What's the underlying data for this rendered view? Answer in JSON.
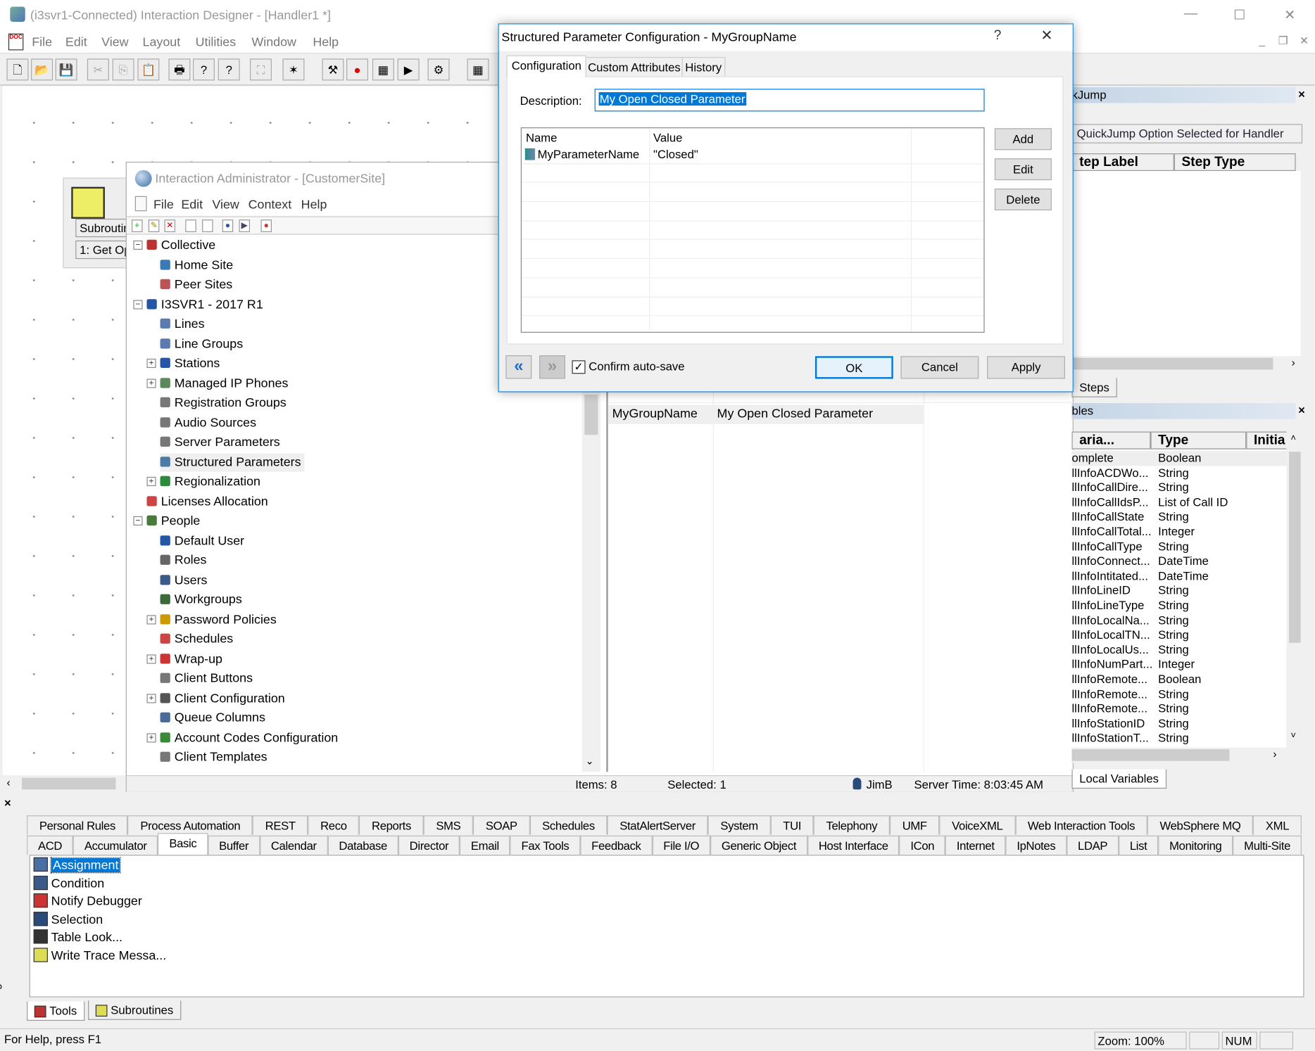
{
  "window": {
    "title": "(i3svr1-Connected) Interaction Designer - [Handler1 *]",
    "controls": [
      "—",
      "☐",
      "✕"
    ],
    "mdi_controls": [
      "_",
      "❐",
      "✕"
    ]
  },
  "menu": [
    "File",
    "Edit",
    "View",
    "Layout",
    "Utilities",
    "Window",
    "Help"
  ],
  "toolbar": [
    "new-icon",
    "open-icon",
    "save-icon",
    "cut-icon",
    "copy-icon",
    "paste-icon",
    "print-icon",
    "help-icon",
    "context-help-icon",
    "publish-icon",
    "debug-icon",
    "tools-icon",
    "stop-icon",
    "grid-icon",
    "step-icon",
    "variables-icon",
    "layout-grid-icon"
  ],
  "canvas": {
    "step_title": "Subroutin",
    "step_label": "1: Get Op"
  },
  "admin": {
    "title": "Interaction Administrator - [CustomerSite]",
    "menu": [
      "File",
      "Edit",
      "View",
      "Context",
      "Help"
    ],
    "tree": [
      {
        "label": "Collective",
        "level": 0,
        "exp": "-",
        "color": "#b33"
      },
      {
        "label": "Home Site",
        "level": 1,
        "color": "#3a7ab5"
      },
      {
        "label": "Peer Sites",
        "level": 1,
        "color": "#b55"
      },
      {
        "label": "I3SVR1 - 2017 R1",
        "level": 0,
        "exp": "-",
        "color": "#2456a5"
      },
      {
        "label": "Lines",
        "level": 1,
        "color": "#5a7ab0"
      },
      {
        "label": "Line Groups",
        "level": 1,
        "color": "#5a7ab0"
      },
      {
        "label": "Stations",
        "level": 1,
        "exp": "+",
        "color": "#2456a5"
      },
      {
        "label": "Managed IP Phones",
        "level": 1,
        "exp": "+",
        "color": "#5a8a5a"
      },
      {
        "label": "Registration Groups",
        "level": 1,
        "color": "#777"
      },
      {
        "label": "Audio Sources",
        "level": 1,
        "color": "#777"
      },
      {
        "label": "Server Parameters",
        "level": 1,
        "color": "#777"
      },
      {
        "label": "Structured Parameters",
        "level": 1,
        "color": "#4a7aa5",
        "selected": true
      },
      {
        "label": "Regionalization",
        "level": 1,
        "exp": "+",
        "color": "#2a8a3a"
      },
      {
        "label": "Licenses Allocation",
        "level": 0,
        "color": "#c44"
      },
      {
        "label": "People",
        "level": 0,
        "exp": "-",
        "color": "#4a7a3a"
      },
      {
        "label": "Default User",
        "level": 1,
        "color": "#2456a5"
      },
      {
        "label": "Roles",
        "level": 1,
        "color": "#666"
      },
      {
        "label": "Users",
        "level": 1,
        "color": "#3a5a8a"
      },
      {
        "label": "Workgroups",
        "level": 1,
        "color": "#3a6a3a"
      },
      {
        "label": "Password Policies",
        "level": 1,
        "exp": "+",
        "color": "#c90"
      },
      {
        "label": "Schedules",
        "level": 1,
        "color": "#c44"
      },
      {
        "label": "Wrap-up",
        "level": 1,
        "exp": "+",
        "color": "#c33"
      },
      {
        "label": "Client Buttons",
        "level": 1,
        "color": "#777"
      },
      {
        "label": "Client Configuration",
        "level": 1,
        "exp": "+",
        "color": "#555"
      },
      {
        "label": "Queue Columns",
        "level": 1,
        "color": "#4a6a9a"
      },
      {
        "label": "Account Codes Configuration",
        "level": 1,
        "exp": "+",
        "color": "#3a8a3a"
      },
      {
        "label": "Client Templates",
        "level": 1,
        "color": "#777"
      }
    ],
    "list_rows": [
      {
        "name": "MyGroupName",
        "description": "My Open Closed Parameter"
      }
    ],
    "status": {
      "items": "Items: 8",
      "selected": "Selected: 1",
      "user": "JimB",
      "server_time": "Server Time: 8:03:45 AM"
    }
  },
  "dialog": {
    "title": "Structured Parameter Configuration - MyGroupName",
    "help": "?",
    "close": "✕",
    "tabs": [
      "Configuration",
      "Custom Attributes",
      "History"
    ],
    "active_tab": "Configuration",
    "description_label": "Description:",
    "description_value": "My Open Closed Parameter",
    "columns": [
      "Name",
      "Value"
    ],
    "rows": [
      {
        "name": "MyParameterName",
        "value": "\"Closed\""
      }
    ],
    "buttons": {
      "add": "Add",
      "edit": "Edit",
      "delete": "Delete",
      "ok": "OK",
      "cancel": "Cancel",
      "apply": "Apply",
      "prev": "«",
      "next": "»"
    },
    "confirm_autosave": {
      "label": "Confirm auto-save",
      "checked": true
    }
  },
  "quickjump": {
    "title": "kJump",
    "option": "QuickJump Option Selected for Handler",
    "columns": [
      "tep Label",
      "Step Type"
    ],
    "tab": "Steps"
  },
  "variables": {
    "title": "bles",
    "columns": [
      "aria...",
      "Type",
      "Initia"
    ],
    "tab": "Local Variables",
    "rows": [
      [
        "omplete",
        "Boolean"
      ],
      [
        "llInfoACDWo...",
        "String"
      ],
      [
        "llInfoCallDire...",
        "String"
      ],
      [
        "llInfoCallIdsP...",
        "List of Call ID"
      ],
      [
        "llInfoCallState",
        "String"
      ],
      [
        "llInfoCallTotal...",
        "Integer"
      ],
      [
        "llInfoCallType",
        "String"
      ],
      [
        "llInfoConnect...",
        "DateTime"
      ],
      [
        "llInfoIntitated...",
        "DateTime"
      ],
      [
        "llInfoLineID",
        "String"
      ],
      [
        "llInfoLineType",
        "String"
      ],
      [
        "llInfoLocalNa...",
        "String"
      ],
      [
        "llInfoLocalTN...",
        "String"
      ],
      [
        "llInfoLocalUs...",
        "String"
      ],
      [
        "llInfoNumPart...",
        "Integer"
      ],
      [
        "llInfoRemote...",
        "Boolean"
      ],
      [
        "llInfoRemote...",
        "String"
      ],
      [
        "llInfoRemote...",
        "String"
      ],
      [
        "llInfoStationID",
        "String"
      ],
      [
        "llInfoStationT...",
        "String"
      ]
    ]
  },
  "tools": {
    "tabs_row1": [
      "Personal Rules",
      "Process Automation",
      "REST",
      "Reco",
      "Reports",
      "SMS",
      "SOAP",
      "Schedules",
      "StatAlertServer",
      "System",
      "TUI",
      "Telephony",
      "UMF",
      "VoiceXML",
      "Web Interaction Tools",
      "WebSphere MQ",
      "XML"
    ],
    "tabs_row2": [
      "ACD",
      "Accumulator",
      "Basic",
      "Buffer",
      "Calendar",
      "Database",
      "Director",
      "Email",
      "Fax Tools",
      "Feedback",
      "File I/O",
      "Generic Object",
      "Host Interface",
      "ICon",
      "Internet",
      "IpNotes",
      "LDAP",
      "List",
      "Monitoring",
      "Multi-Site"
    ],
    "active_tab": "Basic",
    "items": [
      "Assignment",
      "Condition",
      "Notify Debugger",
      "Selection",
      "Table Look...",
      "Write Trace Messa..."
    ],
    "selected_item": "Assignment",
    "side_label": "Design",
    "bottom_tabs": [
      "Tools",
      "Subroutines"
    ]
  },
  "statusbar": {
    "help": "For Help, press F1",
    "zoom": "Zoom: 100%",
    "num": "NUM"
  },
  "colors": {
    "accent": "#0078d7",
    "selection": "#0078d7",
    "panel_header": "#c5d5e6"
  }
}
